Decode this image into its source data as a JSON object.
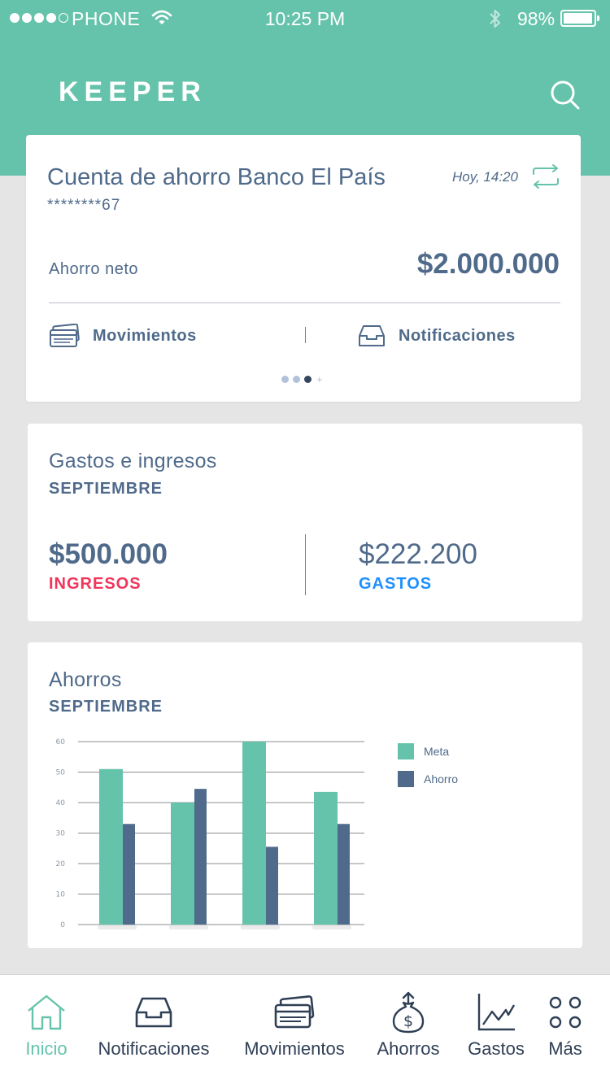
{
  "status_bar": {
    "carrier": "PHONE",
    "time": "10:25 PM",
    "battery": "98%"
  },
  "header": {
    "title": "KEEPER",
    "search_icon": "search-icon"
  },
  "account_card": {
    "name": "Cuenta de ahorro Banco El País",
    "number": "********67",
    "updated": "Hoy, 14:20",
    "net_label": "Ahorro neto",
    "net_value": "$2.000.000",
    "link_movements": "Movimientos",
    "link_notifications": "Notificaciones",
    "pager_plus": "+"
  },
  "gastos_card": {
    "title": "Gastos e ingresos",
    "month": "SEPTIEMBRE",
    "income_value": "$500.000",
    "income_label": "INGRESOS",
    "expense_value": "$222.200",
    "expense_label": "GASTOS"
  },
  "ahorros_card": {
    "title": "Ahorros",
    "month": "SEPTIEMBRE"
  },
  "colors": {
    "accent": "#66c3ab",
    "primary_text": "#4f6a8a",
    "income": "#f0365b",
    "expense": "#1e90ff",
    "meta": "#66c3ab",
    "ahorro": "#4f6a8a"
  },
  "chart_data": {
    "type": "bar",
    "categories": [
      "",
      "",
      "",
      ""
    ],
    "series": [
      {
        "name": "Meta",
        "values": [
          51,
          40,
          60,
          43.5
        ]
      },
      {
        "name": "Ahorro",
        "values": [
          33,
          44.5,
          25.5,
          33
        ]
      }
    ],
    "y_ticks": [
      "0",
      "10",
      "20",
      "30",
      "40",
      "50",
      "60"
    ],
    "ylim": [
      0,
      60
    ],
    "grid": true,
    "legend": "right"
  },
  "tabbar": {
    "items": [
      {
        "label": "Inicio",
        "icon": "home-icon",
        "active": true
      },
      {
        "label": "Notificaciones",
        "icon": "inbox-icon",
        "active": false
      },
      {
        "label": "Movimientos",
        "icon": "cards-icon",
        "active": false
      },
      {
        "label": "Ahorros",
        "icon": "money-bag-icon",
        "active": false
      },
      {
        "label": "Gastos",
        "icon": "line-chart-icon",
        "active": false
      },
      {
        "label": "Más",
        "icon": "more-dots-icon",
        "active": false
      }
    ]
  }
}
